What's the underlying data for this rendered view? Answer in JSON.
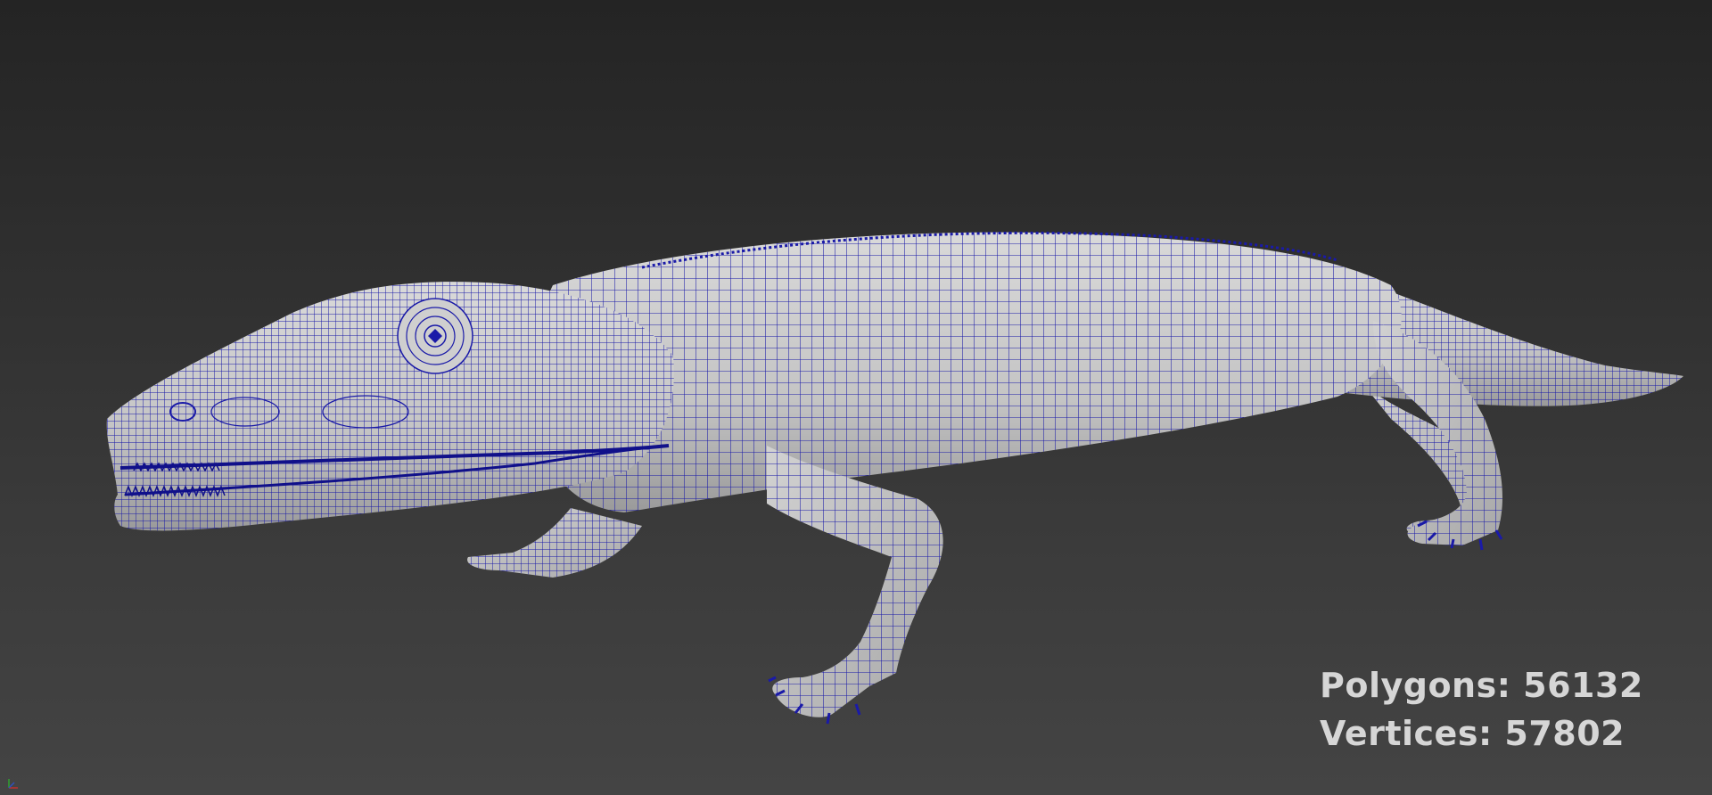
{
  "viewport": {
    "background_top": "#242424",
    "background_bottom": "#444444",
    "model_name_icon": "crocodile-wireframe-model",
    "wire_color": "#1a1aa8",
    "surface_color": "#c8c8c8"
  },
  "stats": {
    "polygons_label": "Polygons: 56132",
    "vertices_label": "Vertices: 57802"
  },
  "axis_gizmo": {
    "icon": "axis-tripod-icon"
  }
}
